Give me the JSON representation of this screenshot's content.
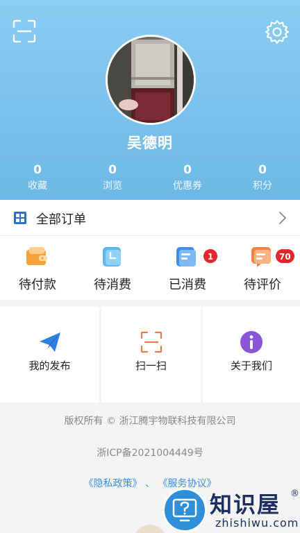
{
  "profile": {
    "name": "吴德明",
    "stats": [
      {
        "value": "0",
        "label": "收藏"
      },
      {
        "value": "0",
        "label": "浏览"
      },
      {
        "value": "0",
        "label": "优惠券"
      },
      {
        "value": "0",
        "label": "积分"
      }
    ]
  },
  "header_icons": {
    "scan": "scan-icon",
    "settings": "gear-icon"
  },
  "orders": {
    "title": "全部订单",
    "statuses": [
      {
        "label": "待付款",
        "icon": "wallet-icon"
      },
      {
        "label": "待消费",
        "icon": "clock-icon"
      },
      {
        "label": "已消费",
        "icon": "list-icon",
        "badge": "1"
      },
      {
        "label": "待评价",
        "icon": "comment-icon",
        "badge": "70"
      }
    ]
  },
  "features": [
    {
      "label": "我的发布",
      "icon": "paper-plane-icon"
    },
    {
      "label": "扫一扫",
      "icon": "scan-icon"
    },
    {
      "label": "关于我们",
      "icon": "info-icon"
    }
  ],
  "footer": {
    "copyright": "版权所有 © 浙江腾宇物联科技有限公司",
    "icp": "浙ICP备2021004449号",
    "privacy_link": "《隐私政策》",
    "separator": "、",
    "service_link": "《服务协议》"
  },
  "watermark": {
    "brand": "知识屋",
    "domain": "zhishiwu.com",
    "reg": "®"
  },
  "colors": {
    "header_gradient_top": "#8ccdf3",
    "header_gradient_bottom": "#6cb8e6",
    "badge_red": "#e5262b",
    "link_blue": "#3a8ee6",
    "plane_blue": "#2f7fe0",
    "scan_orange": "#e57a4a",
    "info_purple": "#8a55d6"
  }
}
